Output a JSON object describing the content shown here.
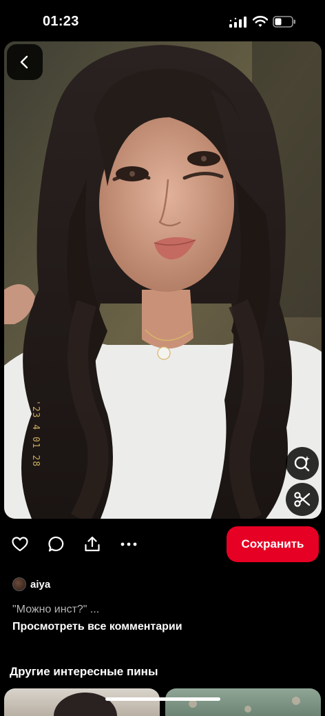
{
  "status_bar": {
    "time": "01:23"
  },
  "pin": {
    "photo_stamp": "'23 4 01 28",
    "author_name": "aiya",
    "comment_preview": "\"Можно инст?\" ...",
    "view_all_comments": "Просмотреть все комментарии"
  },
  "actions": {
    "save_label": "Сохранить"
  },
  "more_pins": {
    "title": "Другие интересные пины"
  },
  "colors": {
    "accent": "#e60023",
    "background": "#000000",
    "muted_text": "#b5b5b5"
  },
  "icons": {
    "back": "chevron-left-icon",
    "visual_search": "visual-search-icon",
    "cutout": "scissors-icon",
    "like": "heart-icon",
    "comment": "comment-icon",
    "share": "share-icon",
    "more": "more-dots-icon"
  }
}
